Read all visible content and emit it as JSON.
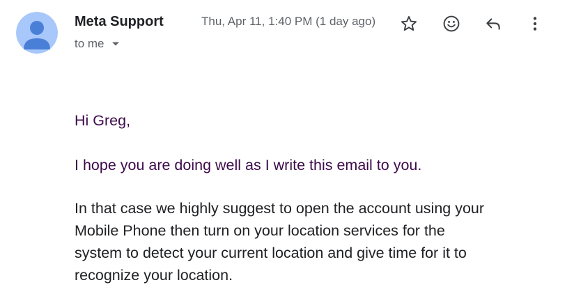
{
  "email": {
    "sender_name": "Meta Support",
    "recipient_label": "to me",
    "timestamp": "Thu, Apr 11, 1:40 PM (1 day ago)"
  },
  "icons": {
    "avatar": "default-avatar-icon",
    "star": "star-icon",
    "emoji": "emoji-reaction-icon",
    "reply": "reply-icon",
    "more": "more-vert-icon",
    "recipient_caret": "caret-down-icon"
  },
  "colors": {
    "avatar_bg": "#a8c7fa",
    "avatar_fg": "#4a7fd8",
    "sender_text": "#202124",
    "meta_text": "#5f6368",
    "quoted_text": "#3d0a4a",
    "body_text": "#202124"
  },
  "message": {
    "greeting": "Hi Greg,",
    "paragraph1": "I hope you are doing well as I write this email to you.",
    "paragraph2_lines": [
      "In that case we highly suggest to open the account using your",
      "Mobile Phone then turn on your location services for the",
      "system to detect your current location and give time for it to",
      "recognize your location."
    ]
  }
}
